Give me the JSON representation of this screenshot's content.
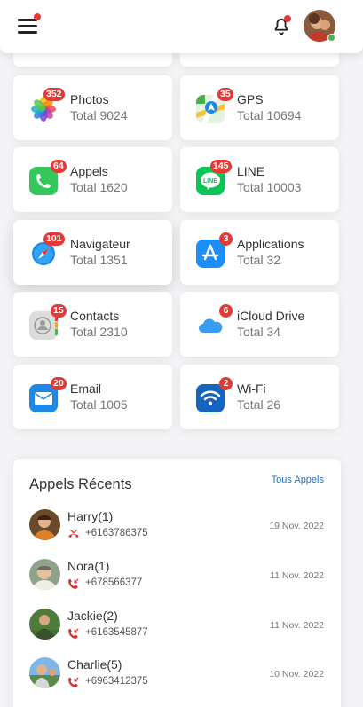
{
  "header": {
    "menu_icon": "hamburger-menu-icon",
    "bell_icon": "bell-icon",
    "avatar": "user-avatar"
  },
  "apps": [
    {
      "name": "Photos",
      "total": "Total 9024",
      "badge": "352",
      "icon": "photos-icon",
      "accent": "#f5a623"
    },
    {
      "name": "GPS",
      "total": "Total 10694",
      "badge": "35",
      "icon": "maps-icon",
      "accent": "#4caf50"
    },
    {
      "name": "Appels",
      "total": "Total 1620",
      "badge": "64",
      "icon": "phone-icon",
      "accent": "#34c759"
    },
    {
      "name": "LINE",
      "total": "Total 10003",
      "badge": "145",
      "icon": "line-icon",
      "accent": "#06c755"
    },
    {
      "name": "Navigateur",
      "total": "Total 1351",
      "badge": "101",
      "icon": "safari-icon",
      "accent": "#1e88e5"
    },
    {
      "name": "Applications",
      "total": "Total 32",
      "badge": "3",
      "icon": "app-store-icon",
      "accent": "#1c8ef9"
    },
    {
      "name": "Contacts",
      "total": "Total 2310",
      "badge": "15",
      "icon": "contacts-icon",
      "accent": "#b0b0b0"
    },
    {
      "name": "iCloud Drive",
      "total": "Total 34",
      "badge": "6",
      "icon": "icloud-icon",
      "accent": "#3a9cf0"
    },
    {
      "name": "Email",
      "total": "Total 1005",
      "badge": "20",
      "icon": "mail-icon",
      "accent": "#1e88e5"
    },
    {
      "name": "Wi-Fi",
      "total": "Total 26",
      "badge": "2",
      "icon": "wifi-icon",
      "accent": "#1565c0"
    }
  ],
  "recent": {
    "title": "Appels Récents",
    "all_link": "Tous Appels",
    "calls": [
      {
        "name": "Harry(1)",
        "number": "+6163786375",
        "date": "19 Nov. 2022",
        "type": "missed-call-icon"
      },
      {
        "name": "Nora(1)",
        "number": "+678566377",
        "date": "11 Nov. 2022",
        "type": "incoming-call-icon"
      },
      {
        "name": "Jackie(2)",
        "number": "+6163545877",
        "date": "11 Nov. 2022",
        "type": "incoming-call-icon"
      },
      {
        "name": "Charlie(5)",
        "number": "+6963412375",
        "date": "10 Nov. 2022",
        "type": "incoming-call-icon"
      }
    ]
  },
  "colors": {
    "badge": "#e53935",
    "link": "#1e73be",
    "call_icon": "#d32f2f"
  }
}
